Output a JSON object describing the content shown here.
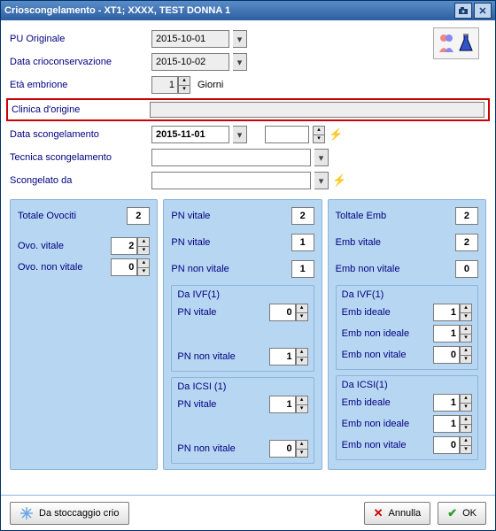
{
  "title": "Crioscongelamento - XT1; XXXX, TEST DONNA 1",
  "form": {
    "pu_orig_label": "PU Originale",
    "pu_orig_value": "2015-10-01",
    "crio_label": "Data crioconservazione",
    "crio_value": "2015-10-02",
    "eta_label": "Età embrione",
    "eta_value": "1",
    "eta_unit": "Giorni",
    "clinica_label": "Clinica d'origine",
    "scong_label": "Data scongelamento",
    "scong_value": "2015-11-01",
    "tecnica_label": "Tecnica scongelamento",
    "sconda_label": "Scongelato da"
  },
  "left": {
    "totale_ovo": "Totale Ovociti",
    "totale_ovo_val": "2",
    "ovo_vitale": "Ovo. vitale",
    "ovo_vitale_val": "2",
    "ovo_non": "Ovo. non vitale",
    "ovo_non_val": "0"
  },
  "mid": {
    "pn_vitale": "PN vitale",
    "pn_vitale_val": "2",
    "pn_vitale2": "PN vitale",
    "pn_vitale2_val": "1",
    "pn_non": "PN non vitale",
    "pn_non_val": "1",
    "ivf_title": "Da IVF(1)",
    "ivf_pn_vit": "PN vitale",
    "ivf_pn_vit_val": "0",
    "ivf_pn_non": "PN non vitale",
    "ivf_pn_non_val": "1",
    "icsi_title": "Da ICSI (1)",
    "icsi_pn_vit": "PN vitale",
    "icsi_pn_vit_val": "1",
    "icsi_pn_non": "PN non vitale",
    "icsi_pn_non_val": "0"
  },
  "right": {
    "tot_emb": "Toltale Emb",
    "tot_emb_val": "2",
    "emb_vit": "Emb vitale",
    "emb_vit_val": "2",
    "emb_non": "Emb non vitale",
    "emb_non_val": "0",
    "ivf_title": "Da IVF(1)",
    "ivf_ideale": "Emb ideale",
    "ivf_ideale_val": "1",
    "ivf_nonid": "Emb non ideale",
    "ivf_nonid_val": "1",
    "ivf_nonvit": "Emb non vitale",
    "ivf_nonvit_val": "0",
    "icsi_title": "Da ICSI(1)",
    "icsi_ideale": "Emb ideale",
    "icsi_ideale_val": "1",
    "icsi_nonid": "Emb non ideale",
    "icsi_nonid_val": "1",
    "icsi_nonvit": "Emb non vitale",
    "icsi_nonvit_val": "0"
  },
  "buttons": {
    "stoccaggio": "Da stoccaggio crio",
    "annulla": "Annulla",
    "ok": "OK"
  }
}
